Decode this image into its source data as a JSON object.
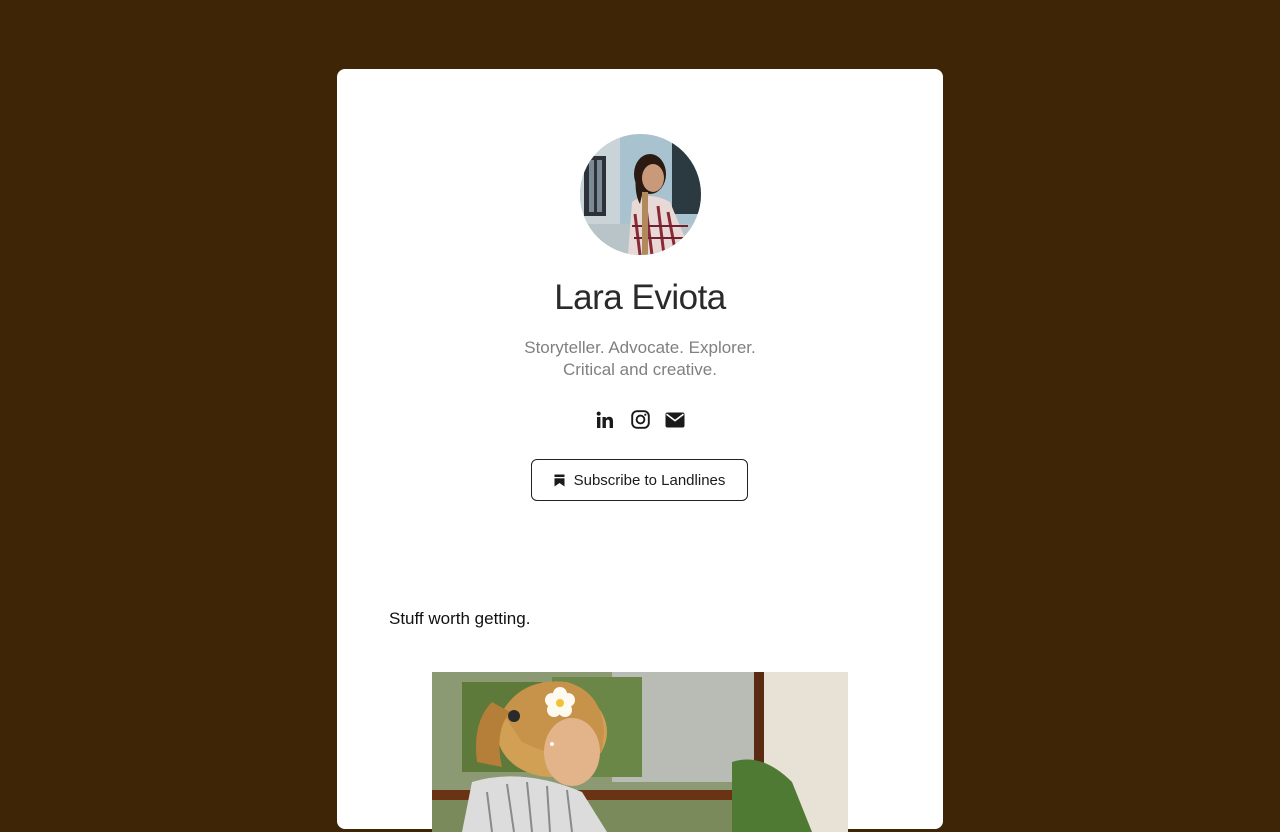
{
  "profile": {
    "name": "Lara Eviota",
    "bio_line1": "Storyteller. Advocate. Explorer.",
    "bio_line2": "Critical and creative."
  },
  "socials": [
    {
      "icon": "linkedin-icon"
    },
    {
      "icon": "instagram-icon"
    },
    {
      "icon": "mail-icon"
    }
  ],
  "subscribe": {
    "label": "Subscribe to Landlines",
    "icon": "bookmark-icon"
  },
  "section": {
    "title": "Stuff worth getting."
  },
  "colors": {
    "background": "#3d2506",
    "card": "#ffffff",
    "name": "#2a2a2a",
    "bio": "#808080"
  }
}
